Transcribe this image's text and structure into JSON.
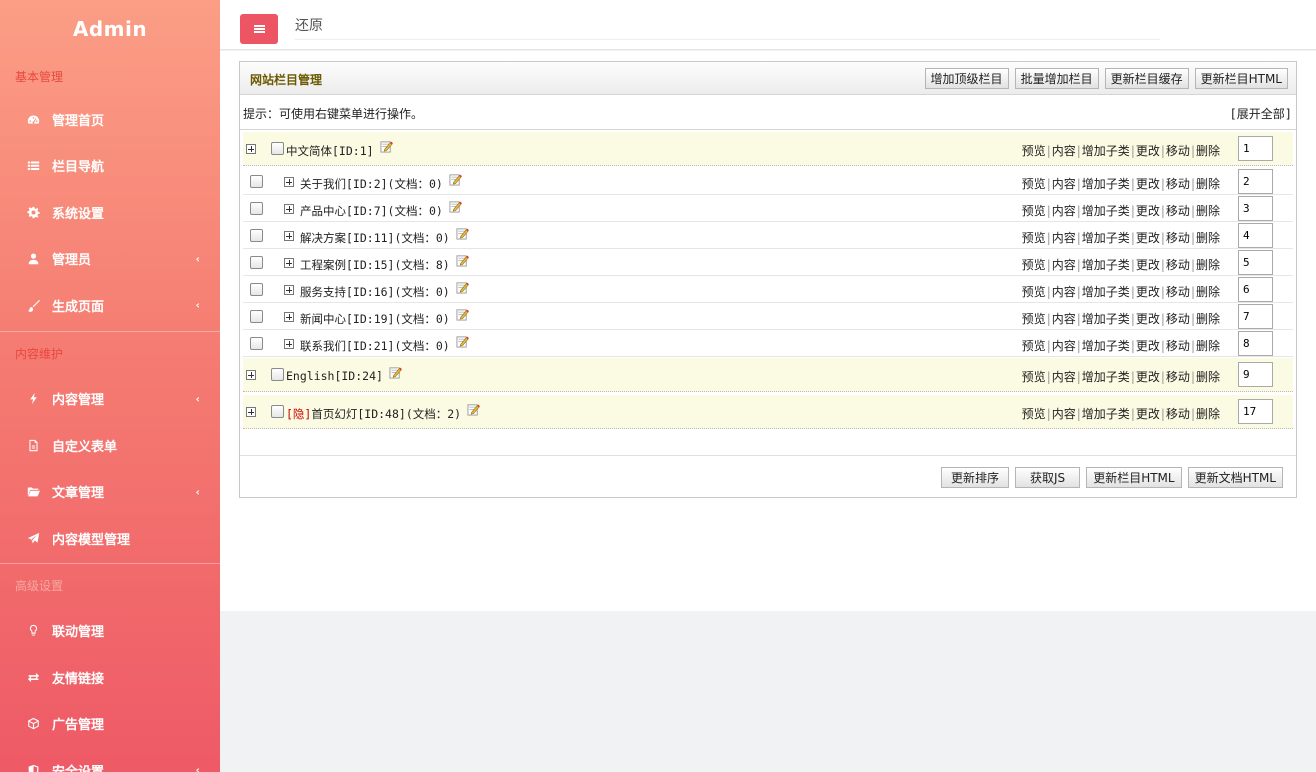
{
  "brand": "Admin",
  "sidebar": {
    "sections": [
      {
        "label": "基本管理"
      },
      {
        "label": "内容维护"
      },
      {
        "label": "高级设置"
      }
    ],
    "items": [
      {
        "label": "管理首页",
        "icon": "dashboard-icon",
        "caret": false
      },
      {
        "label": "栏目导航",
        "icon": "list-icon",
        "caret": false
      },
      {
        "label": "系统设置",
        "icon": "gear-icon",
        "caret": false
      },
      {
        "label": "管理员",
        "icon": "user-icon",
        "caret": true
      },
      {
        "label": "生成页面",
        "icon": "brush-icon",
        "caret": true
      },
      {
        "label": "内容管理",
        "icon": "bolt-icon",
        "caret": true
      },
      {
        "label": "自定义表单",
        "icon": "form-icon",
        "caret": false
      },
      {
        "label": "文章管理",
        "icon": "folder-icon",
        "caret": true
      },
      {
        "label": "内容模型管理",
        "icon": "send-icon",
        "caret": false
      },
      {
        "label": "联动管理",
        "icon": "bulb-icon",
        "caret": false
      },
      {
        "label": "友情链接",
        "icon": "exchange-icon",
        "caret": false
      },
      {
        "label": "广告管理",
        "icon": "cube-icon",
        "caret": false
      },
      {
        "label": "安全设置",
        "icon": "shield-icon",
        "caret": true
      }
    ],
    "caret_glyph": "‹"
  },
  "topbar": {
    "restore_label": "还原"
  },
  "panel": {
    "title": "网站栏目管理",
    "head_buttons": [
      "增加顶级栏目",
      "批量增加栏目",
      "更新栏目缓存",
      "更新栏目HTML"
    ],
    "tip": "提示：可使用右键菜单进行操作。",
    "expand_all": "[展开全部]",
    "ops": [
      "预览",
      "内容",
      "增加子类",
      "更改",
      "移动",
      "删除"
    ],
    "ops_sep": "|",
    "rows": [
      {
        "level": 0,
        "hidden_tag": "",
        "title": "中文简体[ID:1]",
        "sort": "1"
      },
      {
        "level": 1,
        "hidden_tag": "",
        "title": "关于我们[ID:2](文档：0)",
        "sort": "2"
      },
      {
        "level": 1,
        "hidden_tag": "",
        "title": "产品中心[ID:7](文档：0)",
        "sort": "3"
      },
      {
        "level": 1,
        "hidden_tag": "",
        "title": "解决方案[ID:11](文档：0)",
        "sort": "4"
      },
      {
        "level": 1,
        "hidden_tag": "",
        "title": "工程案例[ID:15](文档：8)",
        "sort": "5"
      },
      {
        "level": 1,
        "hidden_tag": "",
        "title": "服务支持[ID:16](文档：0)",
        "sort": "6"
      },
      {
        "level": 1,
        "hidden_tag": "",
        "title": "新闻中心[ID:19](文档：0)",
        "sort": "7"
      },
      {
        "level": 1,
        "hidden_tag": "",
        "title": "联系我们[ID:21](文档：0)",
        "sort": "8"
      },
      {
        "level": 0,
        "hidden_tag": "",
        "title": "English[ID:24]",
        "sort": "9"
      },
      {
        "level": 0,
        "hidden_tag": "[隐]",
        "title": "首页幻灯[ID:48](文档：2)",
        "sort": "17"
      }
    ],
    "foot_buttons": [
      "更新排序",
      "获取JS",
      "更新栏目HTML",
      "更新文档HTML"
    ]
  }
}
